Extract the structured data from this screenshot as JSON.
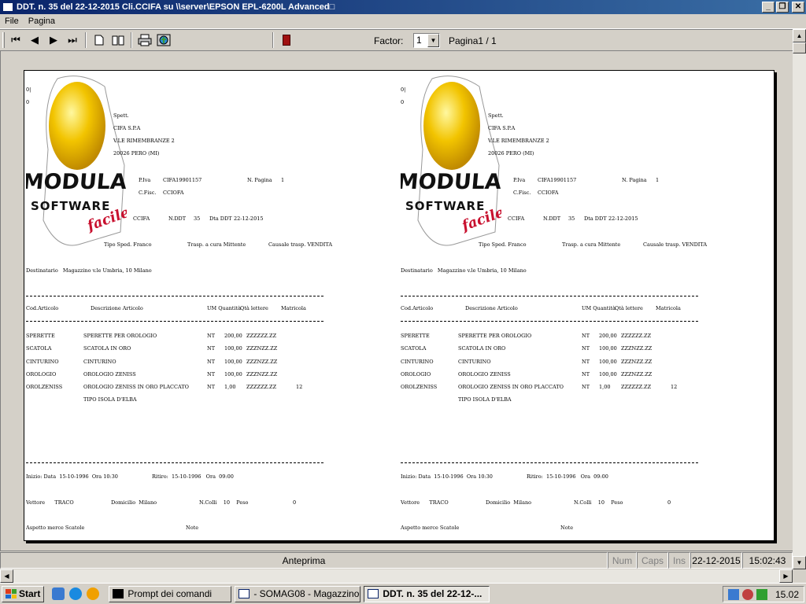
{
  "window": {
    "title": "DDT. n.   35 del 22-12-2015 Cli.CCIFA su \\\\server\\EPSON EPL-6200L Advanced□",
    "min_label": "_",
    "max_label": "❐",
    "close_label": "✕"
  },
  "menu": {
    "items": [
      "File",
      "Pagina"
    ]
  },
  "toolbar": {
    "first_glyph": "⏮",
    "prev_glyph": "◀",
    "next_glyph": "▶",
    "last_glyph": "⏭",
    "factor_label": "Factor:",
    "factor_value": "1",
    "dropdown_glyph": "▼",
    "page_label": "Pagina1 / 1"
  },
  "document": {
    "logo": {
      "line1": "MODULAR",
      "line2": "SOFTWARE",
      "line3": "facile"
    },
    "top_marks": [
      "0|",
      "0"
    ],
    "recipient": [
      "Spett.",
      "CIFA S.P.A",
      "V.LE RIMEMBRANZE 2",
      "20026 PERO (MI)"
    ],
    "piva_label": "P.Iva",
    "piva_value": "CIFA19901157",
    "npagina_label": "N. Pagina",
    "npagina_value": "1",
    "cfisc_label": "C.Fisc.",
    "cfisc_value": "CCIOFA",
    "client_code": "CCIFA",
    "nddt_label": "N.DDT",
    "nddt_value": "35",
    "dta_label": "Dta DDT",
    "dta_value": "22-12-2015",
    "tipo_sped": "Tipo Sped. Franco",
    "trasp": "Trasp. a cura Mittente",
    "causale": "Causale trasp. VENDITA",
    "destinatario": "Destinatario   Magazzino v.le Umbria, 10 Milano",
    "headers": {
      "cod": "Cod.Articolo",
      "desc": "Descrizione Articolo",
      "um_qty": "UM Quantità",
      "qty_letters": "Qtà lettere",
      "matricola": "Matricola"
    },
    "rows": [
      {
        "cod": "SPERETTE",
        "desc": "SPERETTE PER OROLOGIO",
        "um": "NT",
        "qty": "200,00",
        "letters": "ZZZZZZ.ZZ",
        "matr": ""
      },
      {
        "cod": "SCATOLA",
        "desc": "SCATOLA IN ORO",
        "um": "NT",
        "qty": "100,00",
        "letters": "ZZZNZZ.ZZ",
        "matr": ""
      },
      {
        "cod": "CINTURINO",
        "desc": "CINTURINO",
        "um": "NT",
        "qty": "100,00",
        "letters": "ZZZNZZ.ZZ",
        "matr": ""
      },
      {
        "cod": "OROLOGIO",
        "desc": "OROLOGIO ZENISS",
        "um": "NT",
        "qty": "100,00",
        "letters": "ZZZNZZ.ZZ",
        "matr": ""
      },
      {
        "cod": "OROLZENISS",
        "desc": "OROLOGIO ZENISS IN ORO PLACCATO",
        "um": "NT",
        "qty": "1,00",
        "letters": "ZZZZZZ.ZZ",
        "matr": "12"
      }
    ],
    "extra_line": "TIPO ISOLA D'ELBA",
    "inizio": "Inizio: Data  15-10-1996  Ora 10:30",
    "ritiro": "Ritiro:  15-10-1996   Ora  09:00",
    "vettore": "Vettore      TRACO",
    "domicilio": "Domicilio  Milano",
    "ncolli": "N.Colli    10    Peso",
    "peso": "0",
    "aspetto": "Aspetto merce Scatole",
    "note": "Note"
  },
  "status": {
    "mode": "Anteprima",
    "num": "Num",
    "caps": "Caps",
    "ins": "Ins",
    "date": "22-12-2015",
    "time": "15:02:43"
  },
  "taskbar": {
    "start": "Start",
    "tasks": [
      "Prompt dei comandi",
      "- SOMAG08 - Magazzino ...",
      "DDT. n.   35 del 22-12-..."
    ],
    "clock": "15.02"
  },
  "colors": {
    "title_start": "#0a246a",
    "title_end": "#3a6ea5",
    "logo_yellow": "#f2c400",
    "logo_red": "#c8102e"
  }
}
